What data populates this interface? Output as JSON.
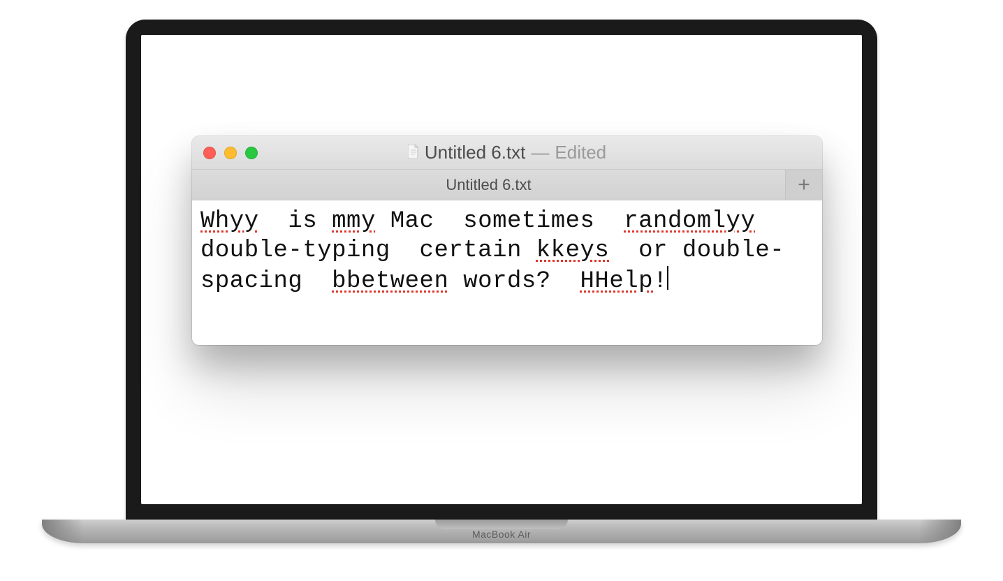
{
  "device": {
    "label": "MacBook Air"
  },
  "window": {
    "traffic_lights": {
      "close": "close",
      "minimize": "minimize",
      "maximize": "maximize"
    },
    "title": {
      "doc_icon": "document-icon",
      "filename": "Untitled 6.txt",
      "separator": "—",
      "status": "Edited"
    },
    "tabs": [
      {
        "label": "Untitled 6.txt"
      }
    ],
    "new_tab_label": "+"
  },
  "editor": {
    "tokens": [
      {
        "t": "Whyy",
        "spell": true
      },
      {
        "t": "  is "
      },
      {
        "t": "mmy",
        "spell": true
      },
      {
        "t": " Mac  sometimes  "
      },
      {
        "t": "randomlyy",
        "spell": true
      },
      {
        "t": " double-typing  certain "
      },
      {
        "t": "kkeys",
        "spell": true
      },
      {
        "t": "  or double-spacing  "
      },
      {
        "t": "bbetween",
        "spell": true
      },
      {
        "t": " words?  "
      },
      {
        "t": "HHelp",
        "spell": true
      },
      {
        "t": "!"
      }
    ],
    "plain_text": "Whyy  is mmy Mac  sometimes  randomlyy double-typing  certain kkeys  or double-spacing  bbetween words?  HHelp!"
  }
}
